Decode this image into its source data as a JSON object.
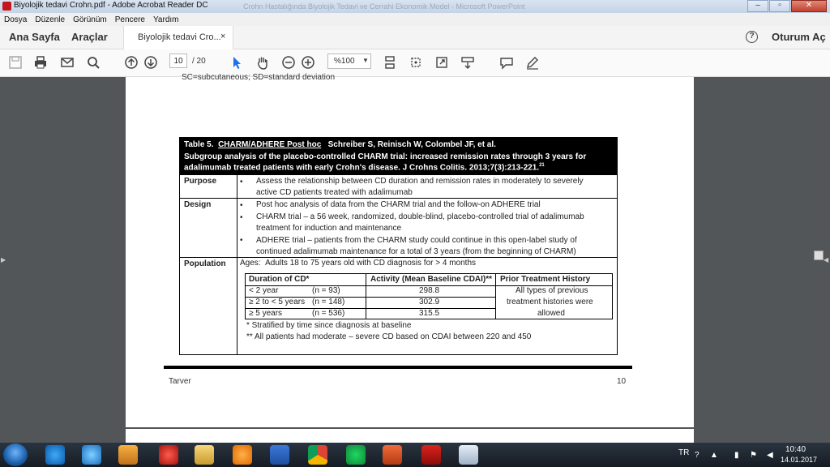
{
  "window": {
    "title": "Biyolojik tedavi Crohn.pdf - Adobe Acrobat Reader DC",
    "blurred_title": "Crohn Hastalığında Biyolojik Tedavi ve Cerrahi Ekonomik Model - Microsoft PowerPoint",
    "controls": [
      "–",
      "▫",
      "✕"
    ]
  },
  "menu": [
    "Dosya",
    "Düzenle",
    "Görünüm",
    "Pencere",
    "Yardım"
  ],
  "nav": {
    "home": "Ana Sayfa",
    "tools": "Araçlar",
    "signin": "Oturum Aç",
    "help": "?"
  },
  "tab": {
    "label": "Biyolojik tedavi Cro...",
    "close": "×"
  },
  "toolbar": {
    "page_current": "10",
    "page_total": "/ 20",
    "zoom": "%100",
    "icons": [
      "save-icon",
      "print-icon",
      "email-icon",
      "search-icon",
      "page-up-icon",
      "page-down-icon",
      "select-cursor-icon",
      "hand-icon",
      "zoom-out-icon",
      "zoom-in-icon",
      "fit-page-icon",
      "rotate-icon",
      "fullscreen-icon",
      "scroll-mode-icon",
      "comment-icon",
      "pen-icon"
    ]
  },
  "document": {
    "cutoff_text": "SC=subcutaneous; SD=standard deviation",
    "table": {
      "title_prefix": "Table 5.",
      "title_link": "CHARM/ADHERE Post hoc",
      "authors": "Schreiber S, Reinisch W, Colombel JF, et al.",
      "subtitle_1": "Subgroup analysis of the placebo-controlled CHARM trial: increased remission rates through 3 years for",
      "subtitle_2": "adalimumab treated patients with early Crohn's disease. J Crohns Colitis. 2013;7(3):213-221.",
      "ref": "21",
      "purpose_label": "Purpose",
      "purpose_1": "Assess the relationship between CD duration and remission rates in moderately to severely",
      "purpose_2": "active CD patients treated with adalimumab",
      "design_label": "Design",
      "design_1": "Post hoc analysis of data from the CHARM trial and the follow-on ADHERE trial",
      "design_2a": "CHARM trial – a 56 week, randomized, double-blind, placebo-controlled trial of adalimumab",
      "design_2b": "treatment for induction and maintenance",
      "design_3a": "ADHERE trial – patients from the CHARM study could continue in this open-label study of",
      "design_3b": "continued adalimumab maintenance for a total of 3 years (from the beginning of CHARM)",
      "population_label": "Population",
      "ages_label": "Ages:",
      "ages_text": "Adults 18 to 75 years old with CD diagnosis for > 4 months",
      "bullet": "•",
      "sub_headers": [
        "Duration of CD*",
        "Activity (Mean Baseline CDAI)**",
        "Prior Treatment History"
      ],
      "sub_rows": [
        {
          "duration": "< 2 year",
          "n": "(n = 93)",
          "activity": "298.8"
        },
        {
          "duration": "≥ 2 to < 5 years",
          "n": "(n = 148)",
          "activity": "302.9"
        },
        {
          "duration": "≥ 5 years",
          "n": "(n = 536)",
          "activity": "315.5"
        }
      ],
      "prior_1": "All types of previous",
      "prior_2": "treatment histories were",
      "prior_3": "allowed",
      "note_1": "* Stratified by time since diagnosis at baseline",
      "note_2": "** All patients had moderate – severe CD based on CDAI between 220 and 450"
    },
    "footer_left": "Tarver",
    "footer_right": "10"
  },
  "taskbar": {
    "language": "TR",
    "time": "10:40",
    "date": "14.01.2017",
    "apps": [
      "internet-explorer-icon",
      "media-icon",
      "media-player-icon",
      "pin-icon",
      "folder-icon",
      "avast-icon",
      "word-icon",
      "chrome-icon",
      "spotify-icon",
      "office-icon",
      "acrobat-icon",
      "snipping-icon"
    ]
  },
  "colors": {
    "accent": "#1a73e8",
    "dark_bg": "#525659",
    "table_header": "#000000"
  }
}
